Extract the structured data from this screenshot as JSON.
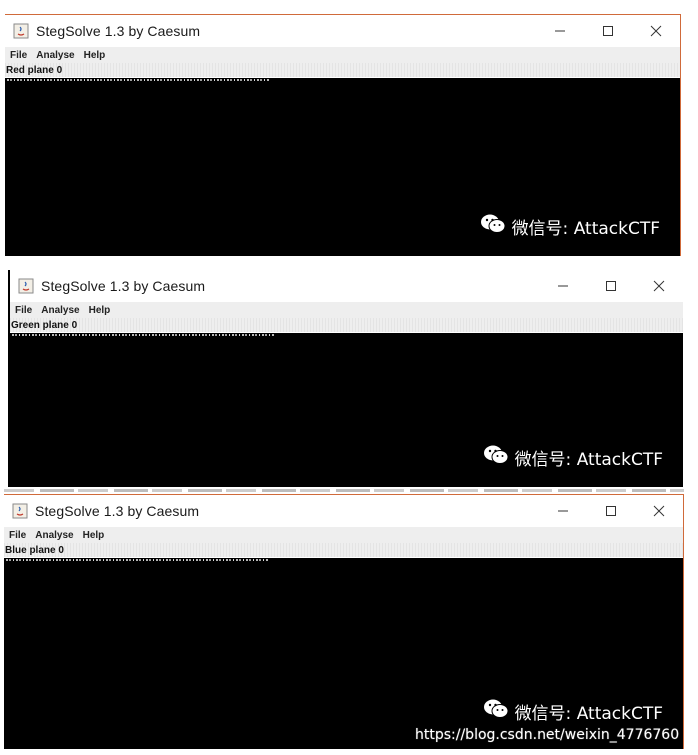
{
  "windows": [
    {
      "title": "StegSolve 1.3 by Caesum",
      "menu": [
        "File",
        "Analyse",
        "Help"
      ],
      "plane_label": "Red plane 0",
      "watermark": "微信号: AttackCTF",
      "controls": {
        "minimize": "minimize",
        "maximize": "maximize",
        "close": "close"
      }
    },
    {
      "title": "StegSolve 1.3 by Caesum",
      "menu": [
        "File",
        "Analyse",
        "Help"
      ],
      "plane_label": "Green plane 0",
      "watermark": "微信号: AttackCTF",
      "controls": {
        "minimize": "minimize",
        "maximize": "maximize",
        "close": "close"
      }
    },
    {
      "title": "StegSolve 1.3 by Caesum",
      "menu": [
        "File",
        "Analyse",
        "Help"
      ],
      "plane_label": "Blue plane 0",
      "watermark": "微信号: AttackCTF",
      "controls": {
        "minimize": "minimize",
        "maximize": "maximize",
        "close": "close"
      }
    }
  ],
  "footer_url": "https://blog.csdn.net/weixin_4776760",
  "colors": {
    "canvas": "#000000",
    "titlebar": "#ffffff",
    "menubar": "#eeeeee",
    "watermark_text": "#ffffff"
  }
}
